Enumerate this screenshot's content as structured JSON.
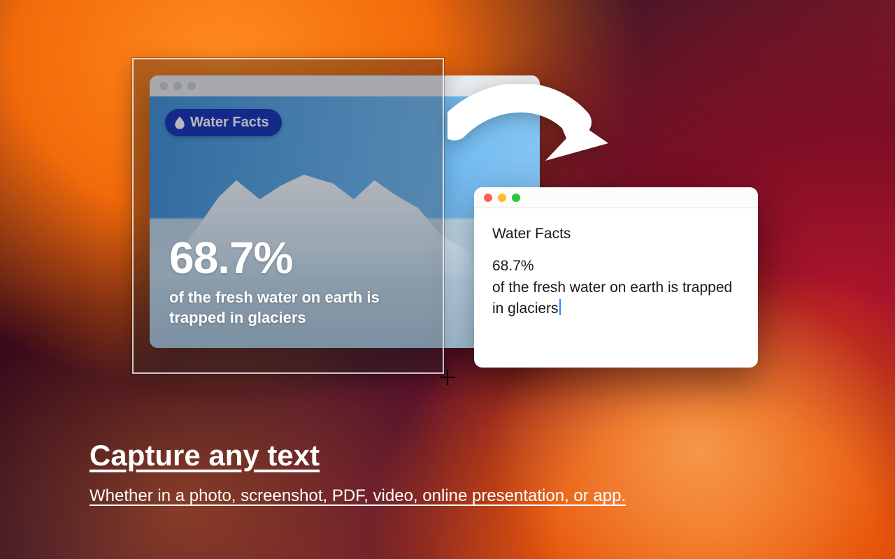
{
  "source_window": {
    "badge_label": "Water Facts",
    "stat_value": "68.7%",
    "stat_description": "of the fresh water on earth is trapped in glaciers"
  },
  "result_window": {
    "line1": "Water Facts",
    "line2": "68.7%",
    "line3": "of the fresh water on earth is trapped in glaciers"
  },
  "caption": {
    "title": "Capture any text",
    "subtitle": "Whether in a photo, screenshot, PDF, video, online presentation, or app."
  },
  "colors": {
    "badge_bg": "#0f2fb8",
    "traffic_red": "#ff5f57",
    "traffic_yellow": "#febc2e",
    "traffic_green": "#28c840",
    "caret": "#1e90ff"
  }
}
